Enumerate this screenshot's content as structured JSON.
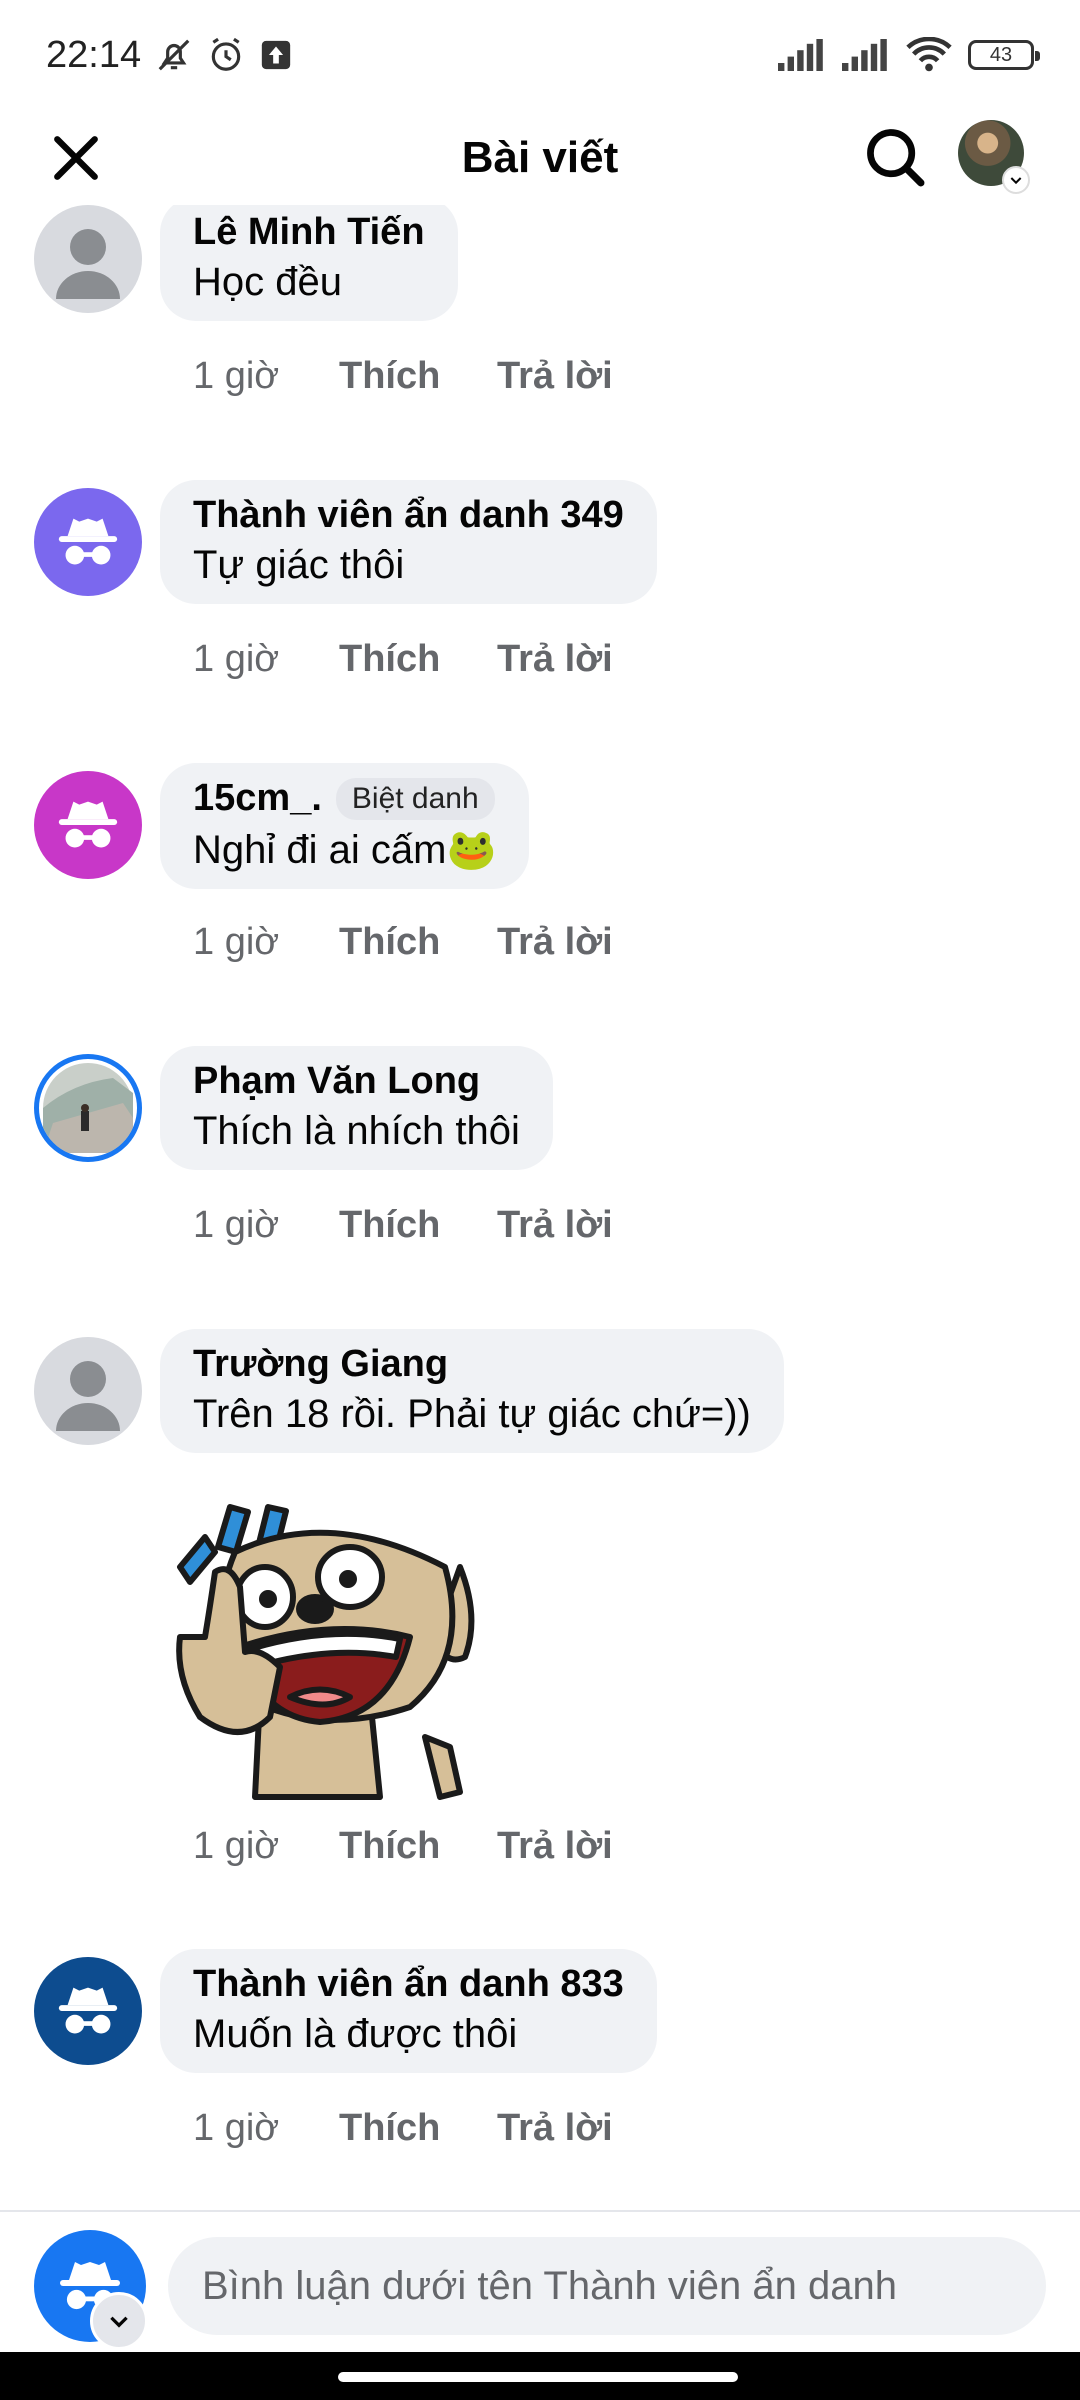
{
  "status_bar": {
    "time": "22:14",
    "battery": "43",
    "left_icons": [
      "bell-off-icon",
      "alarm-icon",
      "upload-icon"
    ],
    "right_icons": [
      "signal-icon",
      "signal-icon",
      "wifi-icon",
      "battery-icon"
    ]
  },
  "header": {
    "title": "Bài viết",
    "close_icon": "close-icon",
    "search_icon": "search-icon"
  },
  "comments": [
    {
      "author": "Lê Minh Tiến",
      "text": "Học đều",
      "avatar": "default",
      "time": "1 giờ",
      "like": "Thích",
      "reply": "Trả lời"
    },
    {
      "author": "Thành viên ẩn danh 349",
      "text": "Tự giác thôi",
      "avatar": "anonymous",
      "avatar_color": "#7b68ee",
      "time": "1 giờ",
      "like": "Thích",
      "reply": "Trả lời"
    },
    {
      "author": "15cm_.",
      "tag": "Biệt danh",
      "text": "Nghỉ đi ai cấm🐸",
      "avatar": "anonymous",
      "avatar_color": "#c837c8",
      "time": "1 giờ",
      "like": "Thích",
      "reply": "Trả lời"
    },
    {
      "author": "Phạm Văn Long",
      "text": "Thích là nhích thôi",
      "avatar": "photo",
      "time": "1 giờ",
      "like": "Thích",
      "reply": "Trả lời"
    },
    {
      "author": "Trường Giang",
      "text": "Trên 18 rồi. Phải tự giác chứ=))",
      "avatar": "default",
      "has_sticker": true,
      "time": "1 giờ",
      "like": "Thích",
      "reply": "Trả lời"
    },
    {
      "author": "Thành viên ẩn danh 833",
      "text": "Muốn là được thôi",
      "avatar": "anonymous",
      "avatar_color": "#0d4c8f",
      "time": "1 giờ",
      "like": "Thích",
      "reply": "Trả lời"
    }
  ],
  "footer": {
    "placeholder": "Bình luận dưới tên Thành viên ẩn danh",
    "avatar_color": "#1877f2"
  }
}
